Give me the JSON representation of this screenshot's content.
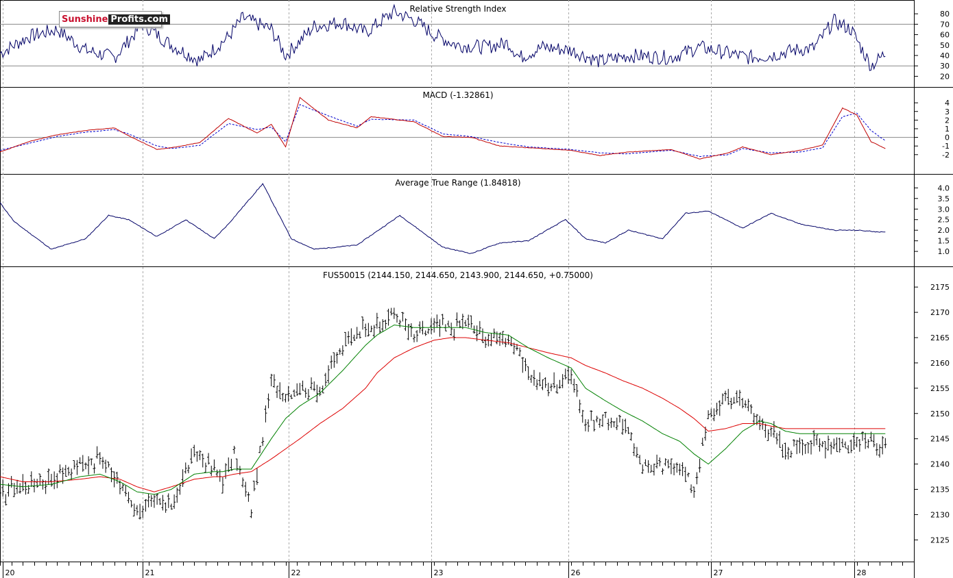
{
  "logo": {
    "part1": "Sunshine",
    "part2": "Profits.com"
  },
  "panels": {
    "rsi_title": "Relative Strength Index",
    "macd_title": "MACD (-1.32861)",
    "atr_title": "Average True Range (1.84818)",
    "price_title": "FUS50015 (2144.150, 2144.650, 2143.900, 2144.650, +0.75000)"
  },
  "colors": {
    "rsi": "#000066",
    "macd": "#c00000",
    "signal": "#0000cc",
    "atr": "#000066",
    "ma_fast": "#008000",
    "ma_slow": "#dd0000",
    "bars": "#000000"
  },
  "chart_data": [
    {
      "type": "line",
      "title": "Relative Strength Index",
      "ylim": [
        15,
        88
      ],
      "yticks": [
        20,
        30,
        40,
        50,
        60,
        70,
        80
      ],
      "levels": [
        30,
        70
      ],
      "x": [
        0,
        5,
        10,
        20,
        30,
        40,
        50,
        60,
        70,
        80,
        85,
        95,
        100,
        110,
        120,
        128,
        138,
        145,
        152,
        160,
        170,
        178,
        182,
        190,
        200,
        210,
        220,
        235,
        245,
        255,
        262,
        270,
        278,
        285,
        292,
        298,
        305,
        310
      ],
      "values": [
        42,
        50,
        58,
        65,
        45,
        38,
        70,
        50,
        35,
        58,
        76,
        65,
        40,
        68,
        72,
        62,
        82,
        74,
        60,
        50,
        48,
        52,
        38,
        48,
        45,
        34,
        40,
        38,
        48,
        42,
        38,
        40,
        45,
        47,
        73,
        65,
        30,
        42
      ]
    },
    {
      "type": "line",
      "title": "MACD (-1.32861)",
      "ylim": [
        -3.6,
        5.2
      ],
      "yticks": [
        -2,
        -1,
        0,
        1,
        2,
        3,
        4
      ],
      "zero_line": 0,
      "x": [
        0,
        10,
        20,
        30,
        40,
        45,
        55,
        60,
        70,
        80,
        90,
        95,
        100,
        105,
        115,
        125,
        130,
        145,
        155,
        165,
        175,
        185,
        200,
        210,
        220,
        235,
        245,
        255,
        260,
        270,
        280,
        288,
        295,
        300,
        305,
        310
      ],
      "series": [
        {
          "values": [
            -1.7,
            -0.5,
            0.3,
            0.8,
            1.1,
            0.2,
            -1.4,
            -1.2,
            -0.6,
            2.2,
            0.5,
            1.5,
            -1.1,
            4.6,
            2.0,
            1.1,
            2.4,
            1.8,
            0.1,
            0.0,
            -1.0,
            -1.2,
            -1.5,
            -2.1,
            -1.7,
            -1.4,
            -2.5,
            -1.8,
            -1.1,
            -2.0,
            -1.5,
            -0.9,
            3.4,
            2.6,
            -0.5,
            -1.3
          ]
        },
        {
          "values": [
            -1.5,
            -0.7,
            0.1,
            0.6,
            0.9,
            0.4,
            -1.0,
            -1.3,
            -0.9,
            1.6,
            0.9,
            1.2,
            -0.5,
            3.8,
            2.5,
            1.3,
            2.1,
            2.0,
            0.4,
            0.1,
            -0.6,
            -1.1,
            -1.4,
            -1.8,
            -1.9,
            -1.5,
            -2.2,
            -2.0,
            -1.3,
            -1.8,
            -1.7,
            -1.2,
            2.4,
            2.8,
            0.8,
            -0.4
          ]
        }
      ]
    },
    {
      "type": "line",
      "title": "Average True Range (1.84818)",
      "ylim": [
        0.55,
        4.4
      ],
      "yticks": [
        1.0,
        1.5,
        2.0,
        2.5,
        3.0,
        3.5,
        4.0
      ],
      "x": [
        0,
        5,
        18,
        30,
        38,
        45,
        55,
        65,
        75,
        80,
        92,
        102,
        110,
        125,
        140,
        155,
        165,
        175,
        185,
        198,
        205,
        212,
        220,
        232,
        240,
        248,
        260,
        270,
        280,
        292,
        300,
        310
      ],
      "values": [
        3.3,
        2.4,
        1.1,
        1.6,
        2.7,
        2.5,
        1.7,
        2.5,
        1.6,
        2.3,
        4.2,
        1.6,
        1.1,
        1.3,
        2.7,
        1.2,
        0.9,
        1.4,
        1.5,
        2.5,
        1.6,
        1.4,
        2.0,
        1.6,
        2.8,
        2.9,
        2.1,
        2.8,
        2.3,
        2.0,
        2.0,
        1.9
      ]
    },
    {
      "type": "line",
      "title": "FUS50015 (2144.150, 2144.650, 2143.900, 2144.650, +0.75000)",
      "ylim": [
        2121.8,
        2178
      ],
      "yticks": [
        2125,
        2130,
        2135,
        2140,
        2145,
        2150,
        2155,
        2160,
        2165,
        2170,
        2175
      ],
      "xlabels": [
        "20",
        "21",
        "22",
        "23",
        "26",
        "27",
        "28"
      ],
      "x": [
        0,
        8,
        18,
        28,
        35,
        42,
        48,
        54,
        60,
        68,
        75,
        78,
        82,
        88,
        95,
        100,
        105,
        112,
        120,
        128,
        132,
        138,
        145,
        152,
        158,
        163,
        170,
        178,
        185,
        192,
        200,
        205,
        212,
        218,
        225,
        232,
        238,
        243,
        248,
        254,
        260,
        266,
        270,
        275,
        280,
        286,
        292,
        298,
        302,
        308,
        310
      ],
      "series": [
        {
          "name": "FUS50015",
          "values": [
            2134,
            2136,
            2137,
            2140,
            2141,
            2136,
            2131,
            2132,
            2132,
            2142,
            2139,
            2137,
            2142,
            2131,
            2156,
            2154,
            2155,
            2155,
            2163,
            2168,
            2167,
            2170,
            2165,
            2167,
            2167,
            2168,
            2165,
            2165,
            2158,
            2155,
            2158,
            2148,
            2149,
            2148,
            2140,
            2139,
            2140,
            2135,
            2149,
            2153,
            2153,
            2148,
            2147,
            2142,
            2144,
            2144,
            2144,
            2144,
            2145,
            2144,
            2144.65
          ]
        },
        {
          "values": [
            2136,
            2135.5,
            2136,
            2137.5,
            2138,
            2136.5,
            2134.5,
            2134,
            2135,
            2138,
            2138.5,
            2138.5,
            2139,
            2139,
            2145,
            2149,
            2151.5,
            2154,
            2158.5,
            2163.5,
            2165.5,
            2167.5,
            2167,
            2167,
            2167,
            2167,
            2166,
            2165.5,
            2163,
            2161,
            2159,
            2155,
            2152.5,
            2150.5,
            2148.5,
            2146,
            2144.5,
            2142,
            2140,
            2143,
            2146.5,
            2148.5,
            2148,
            2146.5,
            2146,
            2146,
            2146,
            2146,
            2146,
            2146,
            2146
          ]
        },
        {
          "values": [
            2137.5,
            2136.5,
            2136.5,
            2137,
            2137.5,
            2137,
            2135.5,
            2134.5,
            2135.5,
            2137,
            2137.5,
            2137.5,
            2138,
            2138.5,
            2141,
            2143,
            2145,
            2148,
            2151,
            2155,
            2158,
            2161,
            2163,
            2164.5,
            2165,
            2165,
            2164.5,
            2164,
            2163,
            2162,
            2161,
            2159.5,
            2158,
            2156.5,
            2155,
            2153,
            2151,
            2149,
            2146.5,
            2147,
            2148,
            2148,
            2147.5,
            2147,
            2147,
            2147,
            2147,
            2147,
            2147,
            2147,
            2147
          ]
        }
      ]
    }
  ]
}
